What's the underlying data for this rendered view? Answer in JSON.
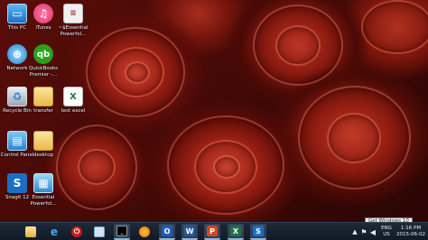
{
  "desktop": {
    "icons": [
      {
        "label": "This PC",
        "icon": "computer-icon"
      },
      {
        "label": "iTunes",
        "icon": "itunes-icon"
      },
      {
        "label": "~$Essential Powerfol...",
        "icon": "document-icon"
      },
      {
        "label": "Network",
        "icon": "network-icon"
      },
      {
        "label": "QuickBooks Premier -...",
        "icon": "quickbooks-icon"
      },
      {
        "label": "Recycle Bin",
        "icon": "recycle-bin-icon"
      },
      {
        "label": "transfer",
        "icon": "folder-icon"
      },
      {
        "label": "test excel",
        "icon": "excel-file-icon"
      },
      {
        "label": "Control Panel",
        "icon": "control-panel-icon"
      },
      {
        "label": "desktop",
        "icon": "folder-icon"
      },
      {
        "label": "Snagit 12",
        "icon": "snagit-icon"
      },
      {
        "label": "Essential Powerfol...",
        "icon": "powerpoint-file-icon"
      }
    ]
  },
  "taskbar": {
    "tooltip": "Get Windows 10",
    "language": {
      "code": "ENG",
      "region": "US"
    },
    "clock": {
      "time": "1:16 PM",
      "date": "2015-06-02"
    },
    "pinned": [
      {
        "icon": "start-icon"
      },
      {
        "icon": "file-explorer-icon"
      },
      {
        "icon": "internet-explorer-icon"
      },
      {
        "icon": "power-icon"
      },
      {
        "icon": "notepad-icon"
      },
      {
        "icon": "command-prompt-icon"
      },
      {
        "icon": "firefox-icon"
      },
      {
        "icon": "outlook-icon"
      },
      {
        "icon": "word-icon"
      },
      {
        "icon": "powerpoint-icon"
      },
      {
        "icon": "excel-icon"
      },
      {
        "icon": "snagit-icon"
      }
    ]
  },
  "colors": {
    "taskbar": "#111a26",
    "accent": "#8fb4e0"
  }
}
